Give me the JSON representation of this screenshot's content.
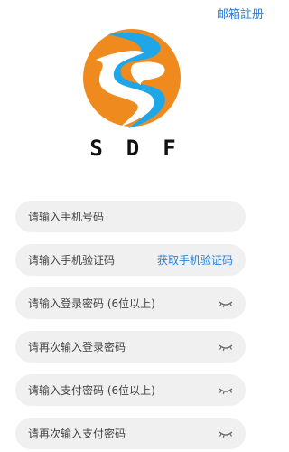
{
  "header": {
    "email_register_label": "邮箱註册"
  },
  "brand": {
    "name": "SDF",
    "logo_icon": "sdf-logo-icon",
    "colors": {
      "orange": "#ef8a1f",
      "blue": "#1ea6e6"
    }
  },
  "form": {
    "phone": {
      "placeholder": "请输入手机号码"
    },
    "sms_code": {
      "placeholder": "请输入手机验证码",
      "get_code_label": "获取手机验证码"
    },
    "login_password": {
      "placeholder": "请输入登录密码 (6位以上)",
      "toggle_icon": "eye-closed-icon"
    },
    "login_password_confirm": {
      "placeholder": "请再次输入登录密码",
      "toggle_icon": "eye-closed-icon"
    },
    "pay_password": {
      "placeholder": "请输入支付密码 (6位以上)",
      "toggle_icon": "eye-closed-icon"
    },
    "pay_password_confirm": {
      "placeholder": "请再次输入支付密码",
      "toggle_icon": "eye-closed-icon"
    }
  },
  "theme": {
    "accent": "#2a7fd4",
    "field_bg": "#f0f0f0"
  }
}
